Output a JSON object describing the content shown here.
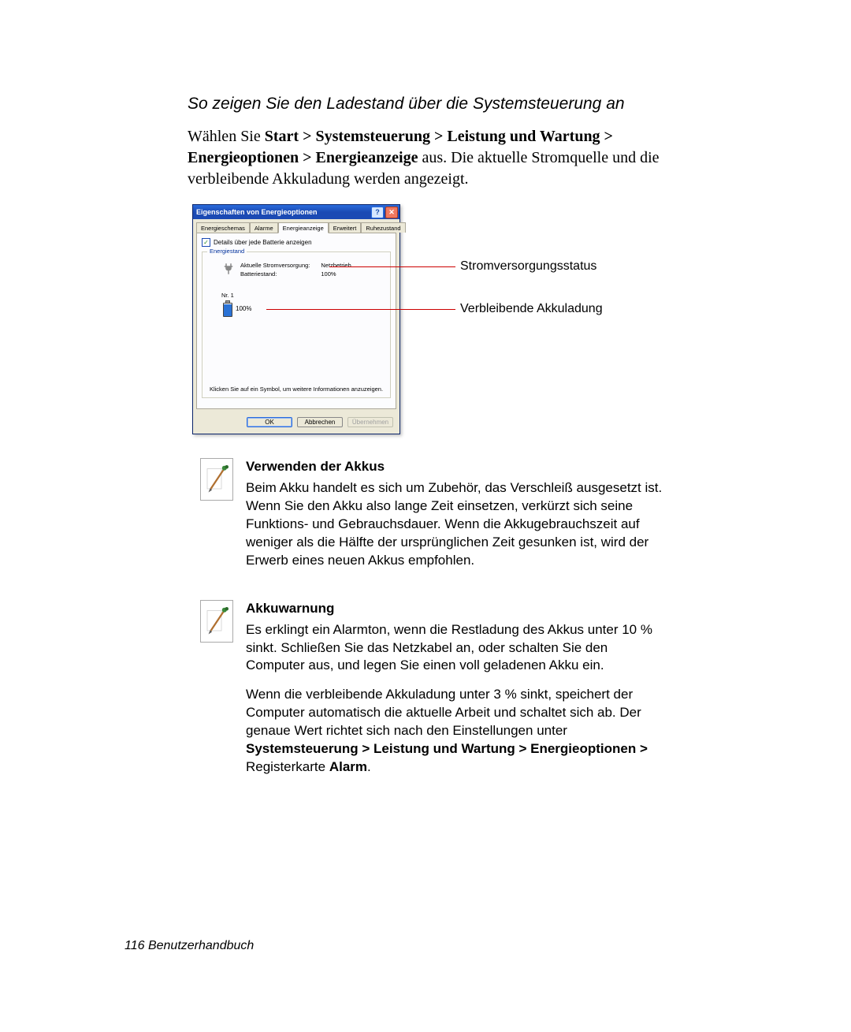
{
  "section_title": "So zeigen Sie den Ladestand über die Systemsteuerung an",
  "intro": {
    "prefix": "Wählen Sie ",
    "bold_path": "Start > Systemsteuerung > Leistung und Wartung > Energieoptionen > Energieanzeige",
    "suffix": " aus. Die aktuelle Stromquelle und die verbleibende Akkuladung werden angezeigt."
  },
  "dialog": {
    "title": "Eigenschaften von Energieoptionen",
    "help_btn": "?",
    "close_btn": "✕",
    "tabs": [
      "Energieschemas",
      "Alarme",
      "Energieanzeige",
      "Erweitert",
      "Ruhezustand"
    ],
    "active_tab_index": 2,
    "checkbox_label": "Details über jede Batterie anzeigen",
    "fieldset_legend": "Energiestand",
    "power_status": {
      "label1": "Aktuelle Stromversorgung:",
      "label2": "Batteriestand:",
      "value1": "Netzbetrieb",
      "value2": "100%"
    },
    "battery_index_label": "Nr. 1",
    "battery_value": "100%",
    "hint": "Klicken Sie auf ein Symbol, um weitere Informationen anzuzeigen.",
    "ok": "OK",
    "cancel": "Abbrechen",
    "apply": "Übernehmen"
  },
  "annotations": {
    "status": "Stromversorgungsstatus",
    "remaining": "Verbleibende Akkuladung"
  },
  "notes": [
    {
      "title": "Verwenden der Akkus",
      "paragraphs": [
        "Beim Akku handelt es sich um Zubehör, das Verschleiß ausgesetzt ist. Wenn Sie den Akku also lange Zeit einsetzen, verkürzt sich seine Funktions- und Gebrauchsdauer. Wenn die Akkugebrauchszeit auf weniger als die Hälfte der ursprünglichen Zeit gesunken ist, wird der Erwerb eines neuen Akkus empfohlen."
      ]
    },
    {
      "title": "Akkuwarnung",
      "paragraphs": [
        "Es erklingt ein Alarmton, wenn die Restladung des Akkus unter 10 % sinkt. Schließen Sie das Netzkabel an, oder schalten Sie den Computer aus, und legen Sie einen voll geladenen Akku ein."
      ],
      "rich_paragraph": {
        "t1": "Wenn die verbleibende Akkuladung unter 3 % sinkt, speichert der Computer automatisch die aktuelle Arbeit und schaltet sich ab. Der genaue Wert richtet sich nach den Einstellungen unter ",
        "b1": "Systemsteuerung > Leistung und Wartung > Energieoptionen > ",
        "t2": "Registerkarte ",
        "b2": "Alarm",
        "t3": "."
      }
    }
  ],
  "footer": "116  Benutzerhandbuch"
}
